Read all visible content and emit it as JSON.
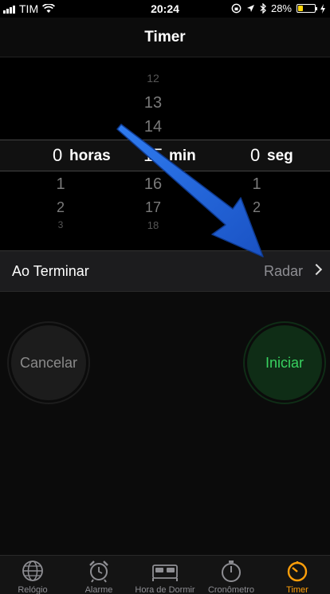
{
  "status_bar": {
    "carrier": "TIM",
    "time": "20:24",
    "battery": "28%",
    "battery_level": 0.28
  },
  "nav": {
    "title": "Timer"
  },
  "picker": {
    "hours": {
      "value": "0",
      "unit": "horas",
      "below": [
        "1",
        "2",
        "3"
      ]
    },
    "minutes": {
      "value": "15",
      "unit": "min",
      "above": [
        "12",
        "13",
        "14"
      ],
      "below": [
        "16",
        "17",
        "18"
      ]
    },
    "seconds": {
      "value": "0",
      "unit": "seg",
      "below": [
        "1",
        "2"
      ]
    }
  },
  "when_done": {
    "label": "Ao Terminar",
    "value": "Radar"
  },
  "buttons": {
    "cancel": "Cancelar",
    "start": "Iniciar"
  },
  "tabs": [
    {
      "label": "Relógio",
      "icon": "globe-icon"
    },
    {
      "label": "Alarme",
      "icon": "alarm-clock-icon"
    },
    {
      "label": "Hora de Dormir",
      "icon": "bed-icon"
    },
    {
      "label": "Cronômetro",
      "icon": "stopwatch-icon"
    },
    {
      "label": "Timer",
      "icon": "timer-icon",
      "active": true
    }
  ],
  "colors": {
    "accent": "#ff9f0a",
    "start_green": "#38d260",
    "arrow_blue": "#1f66d6"
  }
}
